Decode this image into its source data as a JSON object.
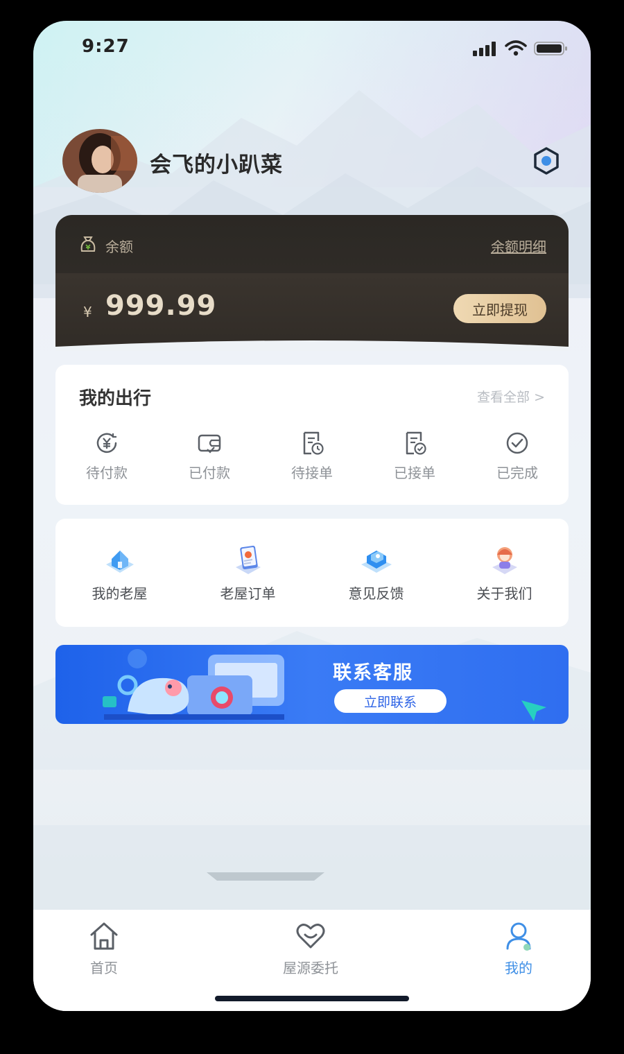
{
  "status_bar": {
    "time": "9:27"
  },
  "profile": {
    "username": "会飞的小趴菜"
  },
  "balance": {
    "label": "余额",
    "detail_link": "余额明细",
    "currency": "¥",
    "amount": "999.99",
    "withdraw_button": "立即提现"
  },
  "travel": {
    "title": "我的出行",
    "view_all": "查看全部 >",
    "items": [
      {
        "label": "待付款",
        "icon": "yen-circle-icon"
      },
      {
        "label": "已付款",
        "icon": "wallet-icon"
      },
      {
        "label": "待接单",
        "icon": "document-clock-icon"
      },
      {
        "label": "已接单",
        "icon": "document-check-icon"
      },
      {
        "label": "已完成",
        "icon": "check-circle-icon"
      }
    ]
  },
  "services": {
    "items": [
      {
        "label": "我的老屋",
        "icon": "house-icon"
      },
      {
        "label": "老屋订单",
        "icon": "order-icon"
      },
      {
        "label": "意见反馈",
        "icon": "feedback-icon"
      },
      {
        "label": "关于我们",
        "icon": "about-icon"
      }
    ]
  },
  "banner": {
    "title": "联系客服",
    "button": "立即联系"
  },
  "tab_bar": {
    "tabs": [
      {
        "label": "首页",
        "icon": "home-icon",
        "active": false
      },
      {
        "label": "屋源委托",
        "icon": "heart-icon",
        "active": false
      },
      {
        "label": "我的",
        "icon": "user-icon",
        "active": true
      }
    ]
  },
  "colors": {
    "accent": "#3f8fe6",
    "card_dark": "#2b2824",
    "gold": "#e7dcc8",
    "banner_blue": "#2f6ef0"
  }
}
